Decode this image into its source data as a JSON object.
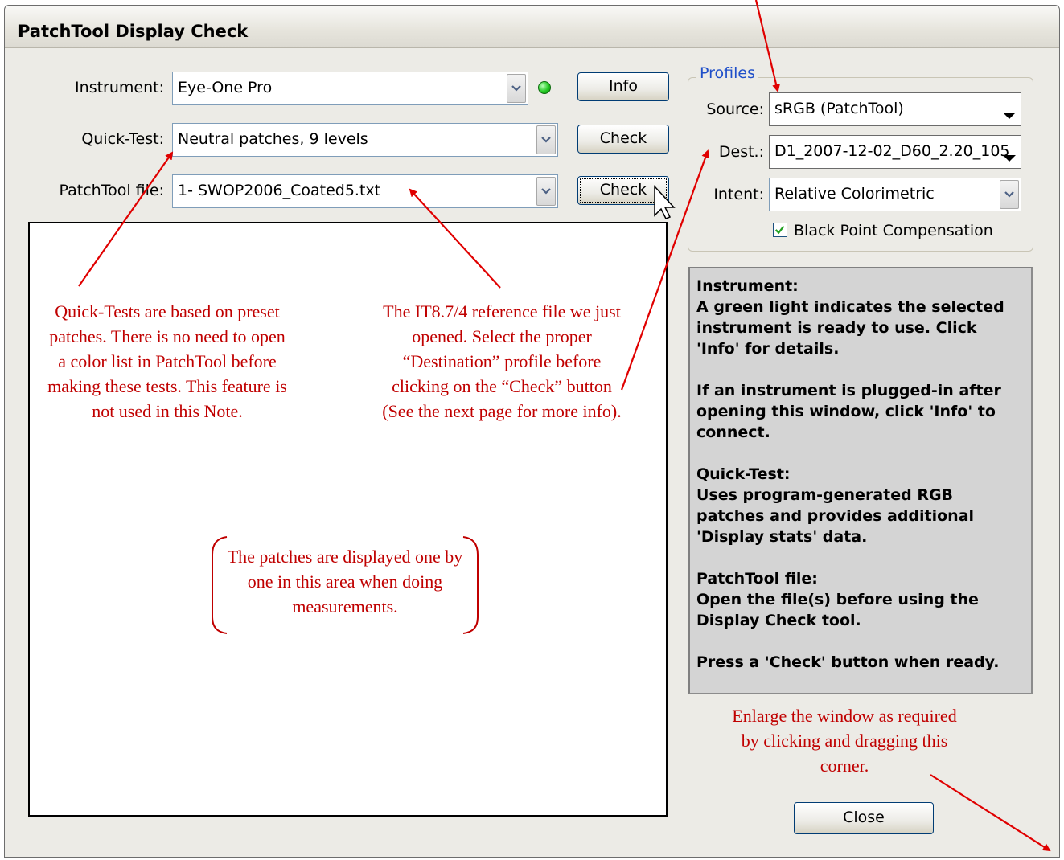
{
  "window": {
    "title": "PatchTool Display Check"
  },
  "instrument": {
    "label": "Instrument:",
    "value": "Eye-One Pro",
    "button": "Info"
  },
  "quick_test": {
    "label": "Quick-Test:",
    "value": "Neutral patches, 9 levels",
    "button": "Check"
  },
  "patchtool_file": {
    "label": "PatchTool file:",
    "value": "1- SWOP2006_Coated5.txt",
    "button": "Check"
  },
  "profiles": {
    "legend": "Profiles",
    "source_label": "Source:",
    "source_value": "sRGB (PatchTool)",
    "dest_label": "Dest.:",
    "dest_value": "D1_2007-12-02_D60_2.20_105",
    "intent_label": "Intent:",
    "intent_value": "Relative Colorimetric",
    "bpc_label": "Black Point Compensation",
    "bpc_checked": true
  },
  "help": {
    "p1": "Instrument:\nA green light indicates the selected instrument is ready to use. Click 'Info' for details.",
    "p2": "If an instrument is plugged-in after opening this window, click 'Info' to connect.",
    "p3": "Quick-Test:\nUses program-generated RGB patches and provides additional 'Display stats' data.",
    "p4": "PatchTool file:\nOpen the file(s) before using the Display Check tool.",
    "p5": "Press a 'Check' button when ready."
  },
  "close_button": "Close",
  "annotations": {
    "quick_tests": "Quick-Tests are based on preset patches. There is no need to open a color list in PatchTool before making these tests. This feature is not used in this Note.",
    "reference_file": "The IT8.7/4 reference file we just opened. Select the proper “Destination” profile before clicking on the “Check” button (See the next page for more info).",
    "patches_area": "The patches are displayed one by one in this area when doing measurements.",
    "enlarge": "Enlarge the window as required by clicking and dragging this corner."
  },
  "colors": {
    "annotation": "#c00000",
    "legend": "#1f4fc9",
    "status_led": "#22c922"
  }
}
